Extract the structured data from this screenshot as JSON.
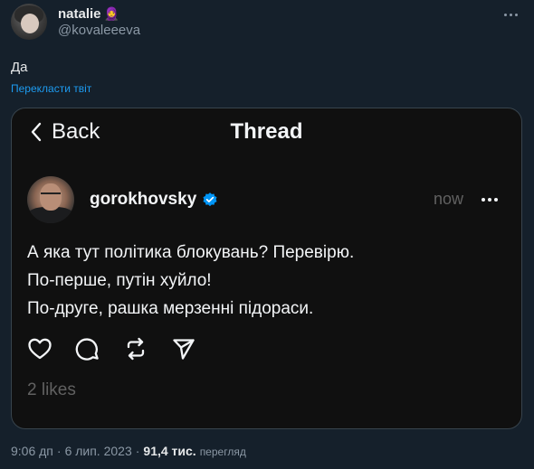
{
  "author": {
    "display_name": "natalie",
    "emoji": "🧕",
    "handle": "@kovaleeeva"
  },
  "tweet": {
    "text": "Да",
    "translate_label": "Перекласти твіт"
  },
  "embedded_thread": {
    "back_label": "Back",
    "title": "Thread",
    "username": "gorokhovsky",
    "time": "now",
    "lines": [
      "А яка тут політика блокувань? Перевірю.",
      "По-перше, путін хуйло!",
      "По-друге, рашка мерзенні підораси."
    ],
    "likes": "2 likes",
    "icons": [
      "heart-icon",
      "comment-icon",
      "repost-icon",
      "share-icon"
    ]
  },
  "meta": {
    "time": "9:06 дп",
    "separator": "·",
    "date": "6 лип. 2023",
    "views_count": "91,4 тис.",
    "views_label": "перегляд"
  },
  "colors": {
    "background": "#15202b",
    "link": "#1d9bf0",
    "secondary_text": "#8b98a5",
    "media_background": "#101010",
    "verified_badge": "#0095f6"
  }
}
